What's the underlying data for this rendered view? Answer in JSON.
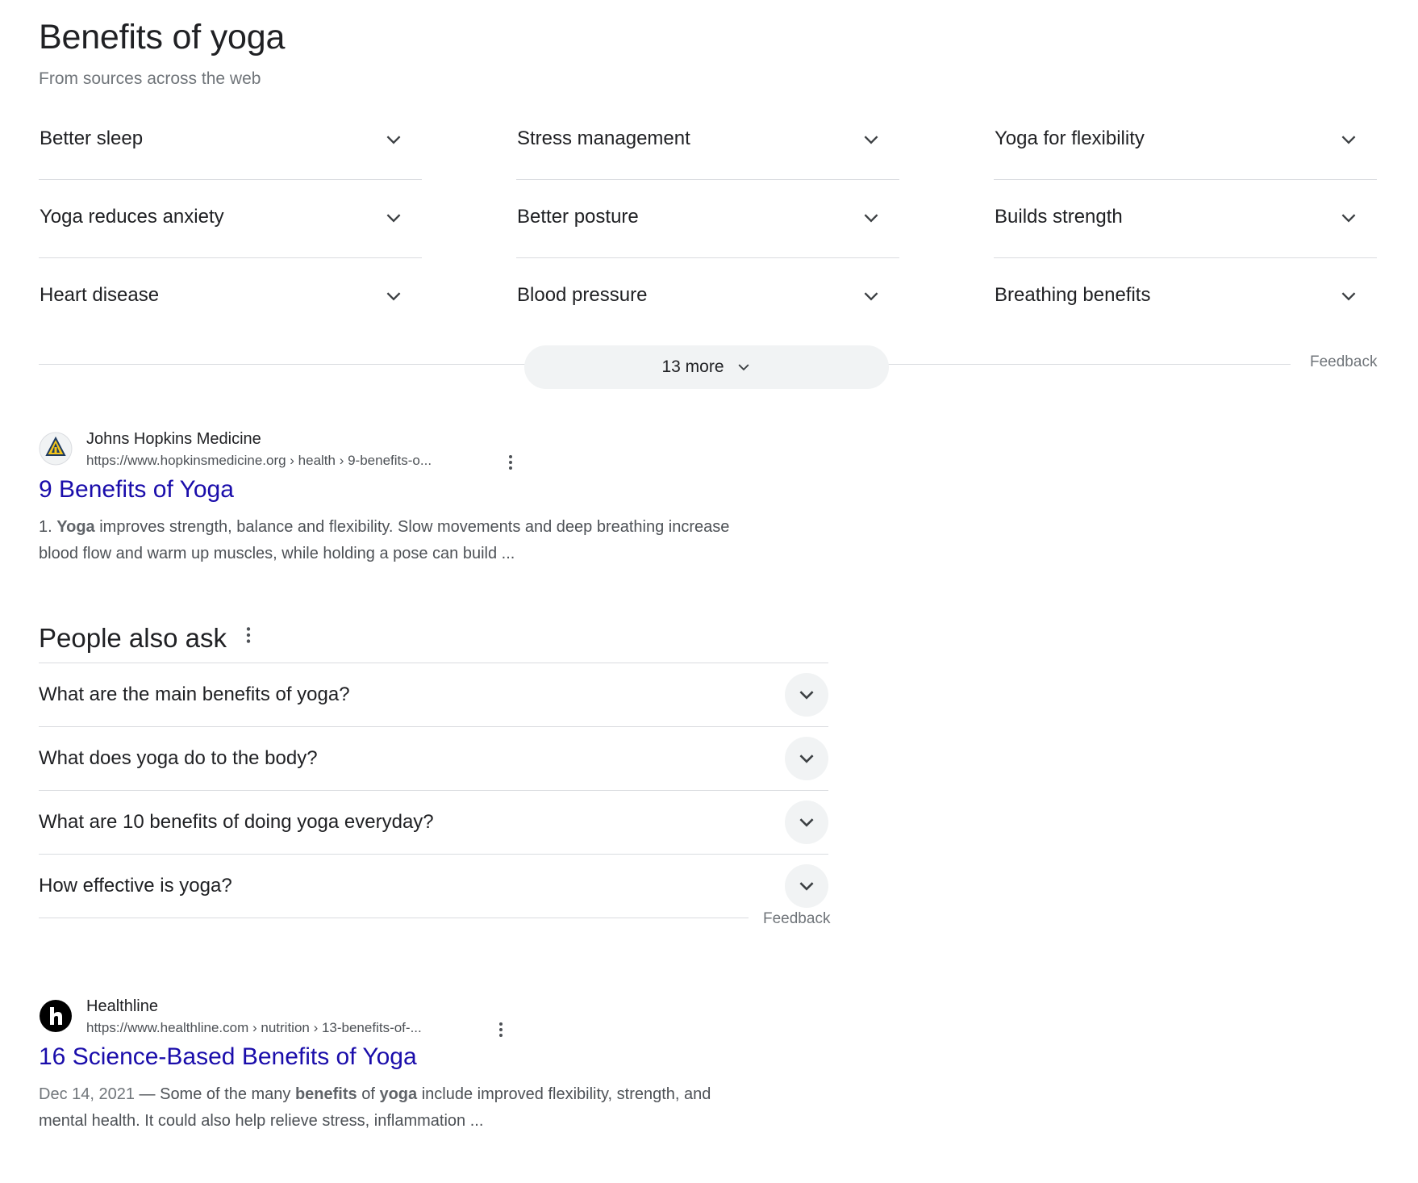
{
  "header": {
    "title": "Benefits of yoga",
    "subtitle": "From sources across the web"
  },
  "benefits": [
    {
      "label": "Better sleep"
    },
    {
      "label": "Stress management"
    },
    {
      "label": "Yoga for flexibility"
    },
    {
      "label": "Yoga reduces anxiety"
    },
    {
      "label": "Better posture"
    },
    {
      "label": "Builds strength"
    },
    {
      "label": "Heart disease"
    },
    {
      "label": "Blood pressure"
    },
    {
      "label": "Breathing benefits"
    }
  ],
  "more_button": {
    "label": "13 more"
  },
  "feedback_label": "Feedback",
  "results": [
    {
      "site_name": "Johns Hopkins Medicine",
      "url": "https://www.hopkinsmedicine.org › health › 9-benefits-o...",
      "title": "9 Benefits of Yoga",
      "snippet_prefix": "1. ",
      "snippet_bold": "Yoga",
      "snippet_line1_rest": " improves strength, balance and flexibility. Slow movements and deep breathing increase",
      "snippet_line2": "blood flow and warm up muscles, while holding a pose can build ..."
    },
    {
      "site_name": "Healthline",
      "url": "https://www.healthline.com › nutrition › 13-benefits-of-...",
      "title": "16 Science-Based Benefits of Yoga",
      "date": "Dec 14, 2021",
      "snippet_a": " — Some of the many ",
      "snippet_bold1": "benefits",
      "snippet_b": " of ",
      "snippet_bold2": "yoga",
      "snippet_c": " include improved flexibility, strength, and",
      "snippet_line2": "mental health. It could also help relieve stress, inflammation ..."
    }
  ],
  "people_also_ask": {
    "title": "People also ask",
    "questions": [
      "What are the main benefits of yoga?",
      "What does yoga do to the body?",
      "What are 10 benefits of doing yoga everyday?",
      "How effective is yoga?"
    ]
  },
  "colors": {
    "link": "#1a0dab",
    "text": "#202124",
    "muted": "#70757a",
    "divider": "#dadce0",
    "chip_bg": "#f1f3f4"
  },
  "icons": {
    "expand": "chevron-down-icon",
    "more_options": "kebab-menu-icon",
    "hopkins_favicon": "hopkins-shield-icon",
    "healthline_favicon": "healthline-logo-icon"
  }
}
